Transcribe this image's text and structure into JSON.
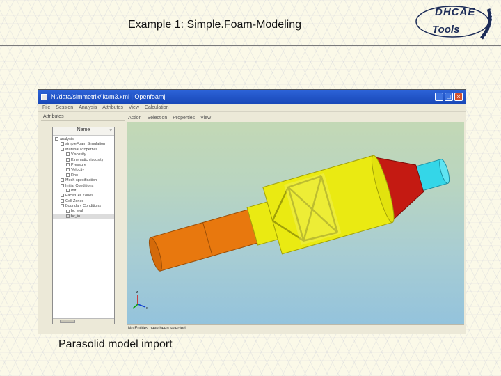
{
  "slide": {
    "title": "Example 1: Simple.Foam-Modeling",
    "caption": "Parasolid model import",
    "logo": {
      "line1": "DHCAE",
      "line2": "Tools"
    }
  },
  "window": {
    "title": "N:/data/simmetrix/ikt/m3.xml | Openfoam|",
    "buttons": {
      "minimize": "_",
      "maximize": "□",
      "close": "×"
    }
  },
  "menubar": {
    "items": [
      "File",
      "Session",
      "Analysis",
      "Attributes",
      "View",
      "Calculation"
    ]
  },
  "left_panel": {
    "header": "Attributes",
    "tree_header": "Name",
    "items": [
      {
        "label": "analysis",
        "depth": 0,
        "selected": false
      },
      {
        "label": "simpleFoam Simulation",
        "depth": 1,
        "selected": false
      },
      {
        "label": "Material Properties",
        "depth": 1,
        "selected": false
      },
      {
        "label": "Viscosity",
        "depth": 2,
        "selected": false
      },
      {
        "label": "Kinematic viscosity",
        "depth": 2,
        "selected": false
      },
      {
        "label": "Pressure",
        "depth": 2,
        "selected": false
      },
      {
        "label": "Velocity",
        "depth": 2,
        "selected": false
      },
      {
        "label": "Rho",
        "depth": 2,
        "selected": false
      },
      {
        "label": "Mesh specification",
        "depth": 1,
        "selected": false
      },
      {
        "label": "Initial Conditions",
        "depth": 1,
        "selected": false
      },
      {
        "label": "Init",
        "depth": 2,
        "selected": false
      },
      {
        "label": "Face/Cell Zones",
        "depth": 1,
        "selected": false
      },
      {
        "label": "Cell Zones",
        "depth": 1,
        "selected": false
      },
      {
        "label": "Boundary Conditions",
        "depth": 1,
        "selected": false
      },
      {
        "label": "bc_wall",
        "depth": 2,
        "selected": false
      },
      {
        "label": "bc_in",
        "depth": 2,
        "selected": true
      }
    ]
  },
  "right_panel": {
    "toolbar": [
      "Action",
      "Selection",
      "Properties",
      "View"
    ],
    "status": "No Entities have been selected"
  },
  "colors": {
    "inlet_pipe": "#e8780e",
    "body": "#eaea12",
    "cone": "#c41a12",
    "outlet": "#34d6e8"
  },
  "icons": {
    "axes": "xyz-axes-icon",
    "app": "application-icon"
  }
}
